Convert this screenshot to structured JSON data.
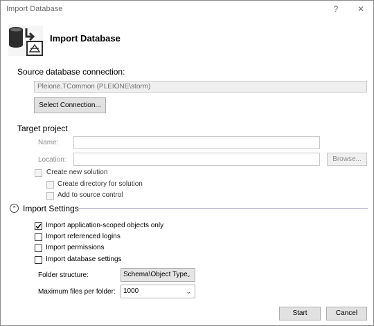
{
  "window": {
    "title": "Import Database",
    "help_glyph": "?",
    "close_glyph": "✕"
  },
  "header": {
    "title": "Import Database"
  },
  "source": {
    "label": "Source database connection:",
    "connection_value": "Pleione.TCommon (PLEIONE\\storm)",
    "select_button": "Select Connection..."
  },
  "target": {
    "label": "Target project",
    "name_label": "Name:",
    "name_value": "",
    "location_label": "Location:",
    "location_value": "",
    "browse_button": "Browse...",
    "create_solution": "Create new solution",
    "create_directory": "Create directory for solution",
    "add_source_control": "Add to source control"
  },
  "settings": {
    "header": "Import Settings",
    "expander_glyph": "⌃",
    "options": [
      {
        "label": "Import application-scoped objects only",
        "checked": true
      },
      {
        "label": "Import referenced logins",
        "checked": false
      },
      {
        "label": "Import permissions",
        "checked": false
      },
      {
        "label": "Import database settings",
        "checked": false
      }
    ],
    "folder_structure_label": "Folder structure:",
    "folder_structure_value": "Schema\\Object Type",
    "max_files_label": "Maximum files per folder:",
    "max_files_value": "1000",
    "dropdown_glyph": "⌄"
  },
  "footer": {
    "start_button": "Start",
    "cancel_button": "Cancel"
  },
  "colors": {
    "disabled_field_bg": "#efefef",
    "button_bg": "#e1e1e1",
    "divider": "#a9a9c6"
  }
}
